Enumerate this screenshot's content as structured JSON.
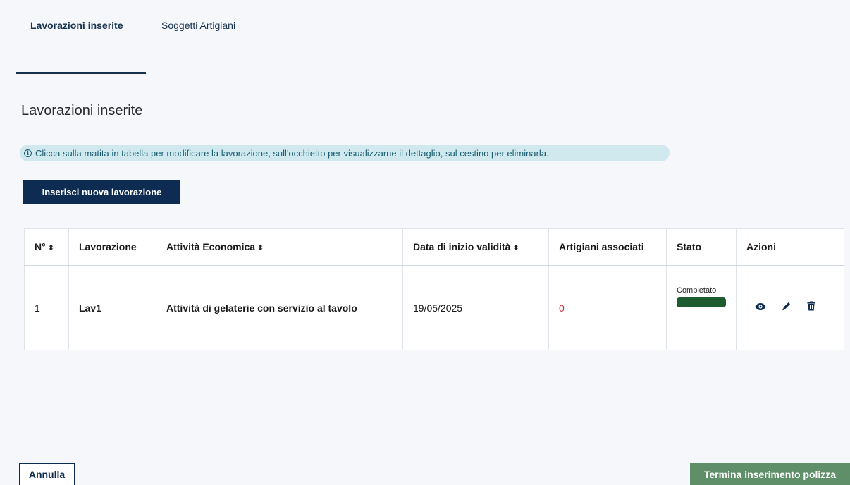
{
  "tabs": [
    {
      "label": "Lavorazioni inserite",
      "active": true
    },
    {
      "label": "Soggetti Artigiani",
      "active": false
    }
  ],
  "section": {
    "title": "Lavorazioni inserite",
    "info_text": "Clicca sulla matita in tabella per modificare la lavorazione, sull'occhietto per visualizzarne il dettaglio, sul cestino per eliminarla.",
    "info_icon": "info-circle-icon"
  },
  "buttons": {
    "add": "Inserisci nuova lavorazione",
    "cancel": "Annulla",
    "finish": "Termina inserimento polizza"
  },
  "table": {
    "headers": {
      "n": "N°",
      "lavorazione": "Lavorazione",
      "attivita": "Attività Economica",
      "data": "Data di inizio validità",
      "artigiani": "Artigiani associati",
      "stato": "Stato",
      "azioni": "Azioni"
    },
    "rows": [
      {
        "n": "1",
        "lavorazione": "Lav1",
        "attivita": "Attività di gelaterie con servizio al tavolo",
        "data": "19/05/2025",
        "artigiani": "0",
        "stato": "Completato",
        "stato_color": "#1e5b2e"
      }
    ]
  },
  "colors": {
    "primary": "#0e2c52",
    "info_bg": "#cfe9ef",
    "finish_bg": "#5e8f68",
    "zero_value": "#c8323f"
  }
}
